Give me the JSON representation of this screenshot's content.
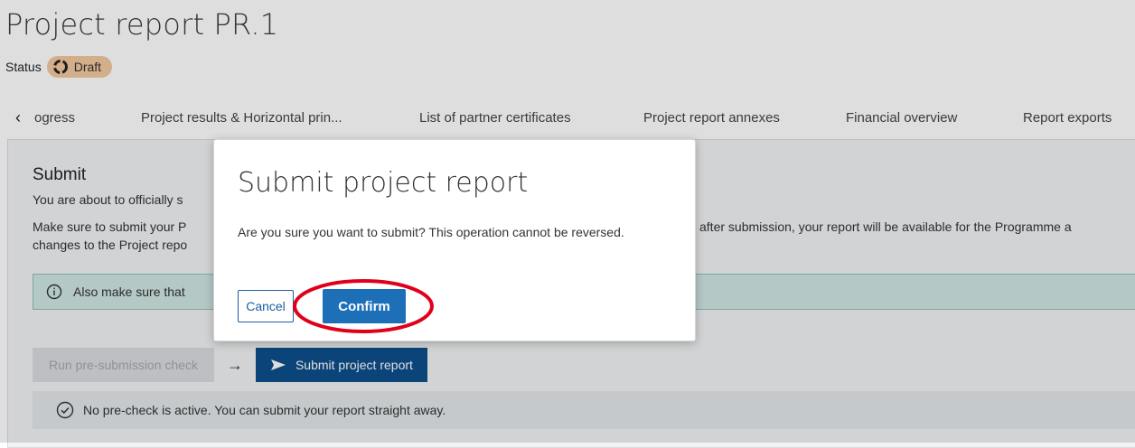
{
  "page": {
    "title": "Project report PR.1",
    "status_label": "Status",
    "status_badge": "Draft"
  },
  "tabs": {
    "prev_icon": "chevron-left-icon",
    "items": [
      {
        "label": "ogress"
      },
      {
        "label": "Project results & Horizontal prin..."
      },
      {
        "label": "List of partner certificates"
      },
      {
        "label": "Project report annexes"
      },
      {
        "label": "Financial overview"
      },
      {
        "label": "Report exports"
      }
    ]
  },
  "submit_section": {
    "heading": "Submit",
    "p1": "You are about to officially s",
    "p2_line1_start": "Make sure to submit your P",
    "p2_line1_end": "after submission, your report will be available for the Programme a",
    "p2_line2": "changes to the Project repo",
    "info_banner": "Also make sure that",
    "precheck_button": "Run pre-submission check",
    "arrow": "→",
    "submit_button": "Submit project report",
    "precheck_message": "No pre-check is active. You can submit your report straight away."
  },
  "modal": {
    "title": "Submit project report",
    "text": "Are you sure you want to submit? This operation cannot be reversed.",
    "cancel_label": "Cancel",
    "confirm_label": "Confirm"
  },
  "colors": {
    "primary": "#1d6fb8",
    "primary_dark": "#0d4f8c",
    "draft_badge": "#f3c89f",
    "info_banner": "#cfe6e3",
    "highlight": "#e0001a"
  }
}
